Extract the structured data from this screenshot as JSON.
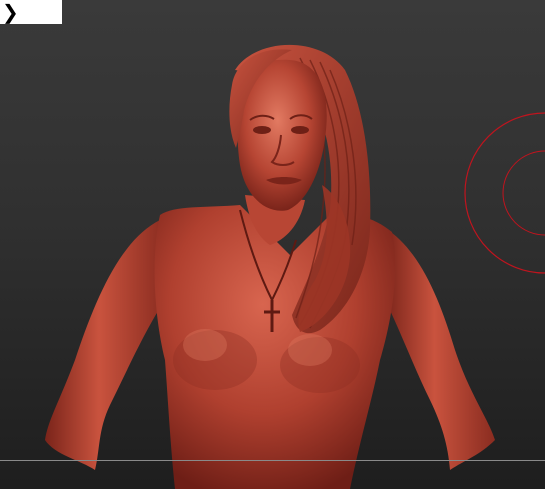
{
  "viewport": {
    "corner_glyph": "❯",
    "colors": {
      "background_top": "#3a3a3a",
      "background_bottom": "#1e1e1e",
      "clay": "#b0402f",
      "clay_highlight": "#d8654f",
      "clay_shadow": "#6e1e16",
      "brush_cursor": "#c0141e",
      "floor_line": "#8a8a8a"
    },
    "icons": [
      "chevron-right-icon",
      "brush-cursor-icon"
    ]
  }
}
